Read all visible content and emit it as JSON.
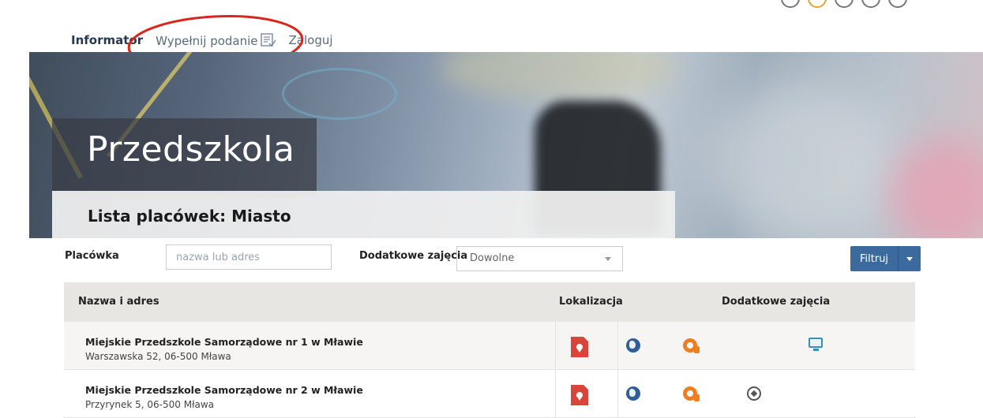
{
  "nav": {
    "tabs": [
      {
        "label": "Informator",
        "active": true
      },
      {
        "label": "Wypełnij podanie",
        "icon": "form-document-icon"
      },
      {
        "label": "Zaloguj"
      }
    ]
  },
  "hero": {
    "title": "Przedszkola",
    "list_prefix": "Lista placówek: ",
    "list_city": "Miasto"
  },
  "filters": {
    "placowka_label": "Placówka",
    "placowka_placeholder": "nazwa lub adres",
    "zajecia_label": "Dodatkowe zajęcia",
    "zajecia_value": "Dowolne",
    "filter_button": "Filtruj"
  },
  "table": {
    "headers": {
      "name": "Nazwa i adres",
      "location": "Lokalizacja",
      "extra": "Dodatkowe zajęcia"
    },
    "rows": [
      {
        "name": "Miejskie Przedszkole Samorządowe nr 1 w Mławie",
        "address": "Warszawska 52, 06-500 Mława",
        "icons": [
          "map-pin-icon",
          "globe-icon",
          "music-icon",
          "computer-icon"
        ]
      },
      {
        "name": "Miejskie Przedszkole Samorządowe nr 2 w Mławie",
        "address": "Przyrynek 5, 06-500 Mława",
        "icons": [
          "map-pin-icon",
          "globe-icon",
          "music-icon",
          "football-icon"
        ]
      }
    ]
  },
  "colors": {
    "primary": "#3a6a9e",
    "pin": "#d9443b",
    "music": "#f07d1f",
    "annotation": "#d9261c"
  }
}
